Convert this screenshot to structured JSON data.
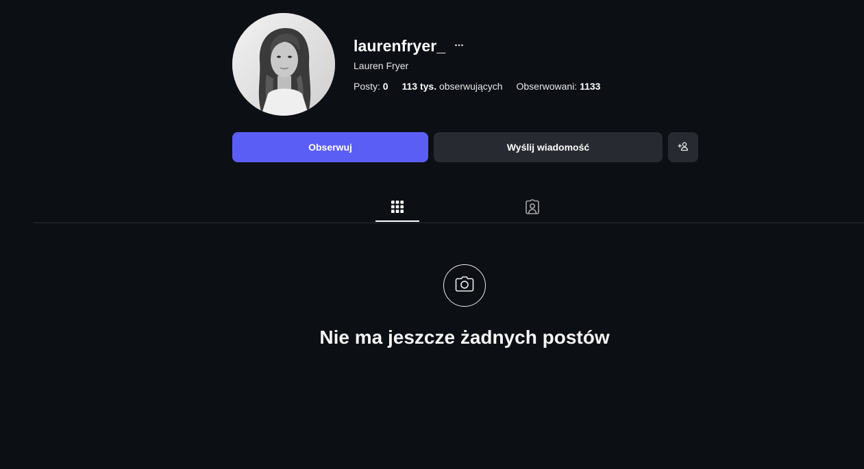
{
  "profile": {
    "username": "laurenfryer_",
    "full_name": "Lauren Fryer",
    "avatar_alt": "profile photo"
  },
  "stats": {
    "posts_label": "Posty:",
    "posts_value": "0",
    "followers_value": "113 tys.",
    "followers_label": "obserwujących",
    "following_label": "Obserwowani:",
    "following_value": "1133"
  },
  "actions": {
    "follow_label": "Obserwuj",
    "message_label": "Wyślij wiadomość",
    "suggest_icon": "add-person-icon"
  },
  "tabs": [
    {
      "name": "posts",
      "icon": "grid-icon",
      "active": true
    },
    {
      "name": "tagged",
      "icon": "tagged-user-icon",
      "active": false
    }
  ],
  "empty_state": {
    "icon": "camera-icon",
    "title": "Nie ma jeszcze żadnych postów"
  },
  "colors": {
    "background": "#0c0f14",
    "primary_button": "#5b5ef5",
    "secondary_button": "#272a30",
    "divider": "#2a2d33"
  }
}
